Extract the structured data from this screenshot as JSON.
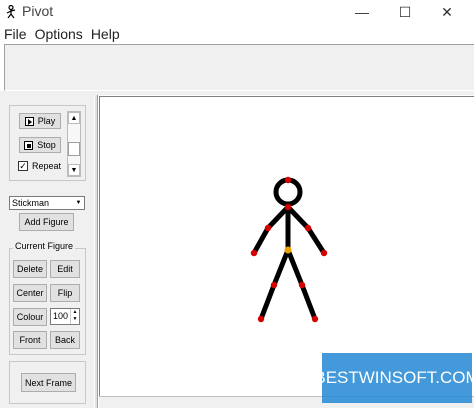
{
  "window": {
    "title": "Pivot",
    "controls": {
      "minimize": "—",
      "maximize": "☐",
      "close": "✕"
    }
  },
  "menu": [
    "File",
    "Options",
    "Help"
  ],
  "playback": {
    "play_label": "Play",
    "stop_label": "Stop",
    "repeat_label": "Repeat",
    "repeat_checked": true
  },
  "figure_select": {
    "value": "Stickman"
  },
  "add_figure_label": "Add Figure",
  "current_figure": {
    "title": "Current Figure",
    "delete_label": "Delete",
    "edit_label": "Edit",
    "center_label": "Center",
    "flip_label": "Flip",
    "colour_label": "Colour",
    "size_value": "100",
    "front_label": "Front",
    "back_label": "Back"
  },
  "next_frame_label": "Next Frame",
  "watermark": "BESTWINSOFT.COM",
  "colors": {
    "figure": "#000000",
    "joint": "#d40000",
    "hip_joint": "#f0a000",
    "watermark_bg": "#2a8cd6"
  }
}
